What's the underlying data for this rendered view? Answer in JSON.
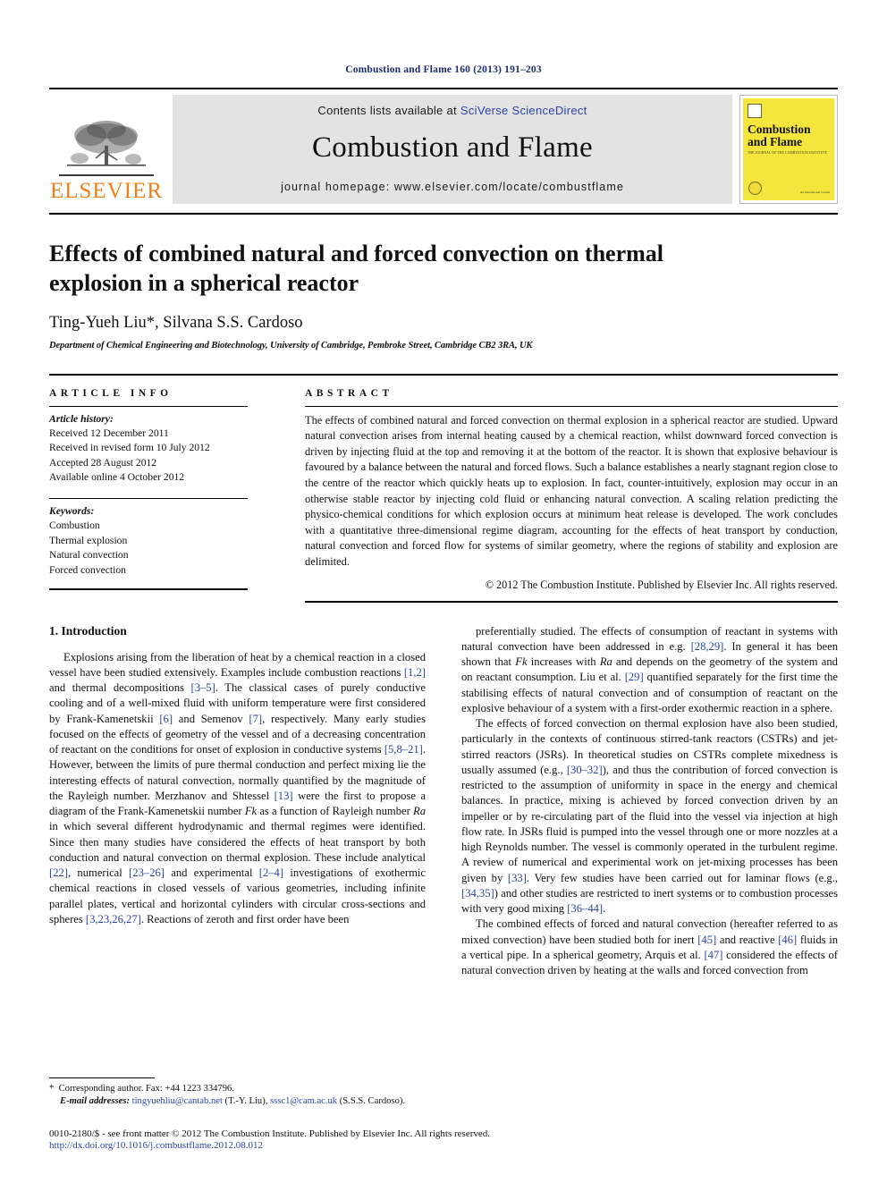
{
  "running_head": "Combustion and Flame 160 (2013) 191–203",
  "masthead": {
    "publisher_name": "ELSEVIER",
    "contents_prefix": "Contents lists available at ",
    "contents_link": "SciVerse ScienceDirect",
    "journal_name": "Combustion and Flame",
    "homepage": "journal homepage: www.elsevier.com/locate/combustflame",
    "cover": {
      "title_line1": "Combustion",
      "title_line2": "and Flame",
      "subtitle": "THE JOURNAL OF THE COMBUSTION INSTITUTE",
      "footer": "An International Journal"
    }
  },
  "article": {
    "title": "Effects of combined natural and forced convection on thermal explosion in a spherical reactor",
    "authors": "Ting-Yueh Liu*, Silvana S.S. Cardoso",
    "affiliation": "Department of Chemical Engineering and Biotechnology, University of Cambridge, Pembroke Street, Cambridge CB2 3RA, UK"
  },
  "article_info": {
    "heading": "ARTICLE INFO",
    "history_label": "Article history:",
    "history": [
      "Received 12 December 2011",
      "Received in revised form 10 July 2012",
      "Accepted 28 August 2012",
      "Available online 4 October 2012"
    ],
    "keywords_label": "Keywords:",
    "keywords": [
      "Combustion",
      "Thermal explosion",
      "Natural convection",
      "Forced convection"
    ]
  },
  "abstract": {
    "heading": "ABSTRACT",
    "text": "The effects of combined natural and forced convection on thermal explosion in a spherical reactor are studied. Upward natural convection arises from internal heating caused by a chemical reaction, whilst downward forced convection is driven by injecting fluid at the top and removing it at the bottom of the reactor. It is shown that explosive behaviour is favoured by a balance between the natural and forced flows. Such a balance establishes a nearly stagnant region close to the centre of the reactor which quickly heats up to explosion. In fact, counter-intuitively, explosion may occur in an otherwise stable reactor by injecting cold fluid or enhancing natural convection. A scaling relation predicting the physico-chemical conditions for which explosion occurs at minimum heat release is developed. The work concludes with a quantitative three-dimensional regime diagram, accounting for the effects of heat transport by conduction, natural convection and forced flow for systems of similar geometry, where the regions of stability and explosion are delimited.",
    "copyright": "© 2012 The Combustion Institute. Published by Elsevier Inc. All rights reserved."
  },
  "body": {
    "section_heading": "1. Introduction",
    "left_p1_a": "Explosions arising from the liberation of heat by a chemical reaction in a closed vessel have been studied extensively. Examples include combustion reactions ",
    "left_ref1": "[1,2]",
    "left_p1_b": " and thermal decompositions ",
    "left_ref2": "[3–5]",
    "left_p1_c": ". The classical cases of purely conductive cooling and of a well-mixed fluid with uniform temperature were first considered by Frank-Kamenetskii ",
    "left_ref3": "[6]",
    "left_p1_d": " and Semenov ",
    "left_ref4": "[7]",
    "left_p1_e": ", respectively. Many early studies focused on the effects of geometry of the vessel and of a decreasing concentration of reactant on the conditions for onset of explosion in conductive systems ",
    "left_ref5": "[5,8–21]",
    "left_p1_f": ". However, between the limits of pure thermal conduction and perfect mixing lie the interesting effects of natural convection, normally quantified by the magnitude of the Rayleigh number. Merzhanov and Shtessel ",
    "left_ref6": "[13]",
    "left_p1_g": " were the first to propose a diagram of the Frank-Kamenetskii number ",
    "left_sym1": "Fk",
    "left_p1_h": " as a function of Rayleigh number ",
    "left_sym2": "Ra",
    "left_p1_i": " in which several different hydrodynamic and thermal regimes were identified. Since then many studies have considered the effects of heat transport by both conduction and natural convection on thermal explosion. These include analytical ",
    "left_ref7": "[22]",
    "left_p1_j": ", numerical ",
    "left_ref8": "[23–26]",
    "left_p1_k": " and experimental ",
    "left_ref9": "[2–4]",
    "left_p1_l": " investigations of exothermic chemical reactions in closed vessels of various geometries, including infinite parallel plates, vertical and horizontal cylinders with circular cross-sections and spheres ",
    "left_ref10": "[3,23,26,27]",
    "left_p1_m": ". Reactions of zeroth and first order have been",
    "right_p1_a": "preferentially studied. The effects of consumption of reactant in systems with natural convection have been addressed in e.g. ",
    "right_ref1": "[28,29]",
    "right_p1_b": ". In general it has been shown that ",
    "right_sym1": "Fk",
    "right_p1_c": " increases with ",
    "right_sym2": "Ra",
    "right_p1_d": " and depends on the geometry of the system and on reactant consumption. Liu et al. ",
    "right_ref2": "[29]",
    "right_p1_e": " quantified separately for the first time the stabilising effects of natural convection and of consumption of reactant on the explosive behaviour of a system with a first-order exothermic reaction in a sphere.",
    "right_p2_a": "The effects of forced convection on thermal explosion have also been studied, particularly in the contexts of continuous stirred-tank reactors (CSTRs) and jet-stirred reactors (JSRs). In theoretical studies on CSTRs complete mixedness is usually assumed (e.g., ",
    "right_ref3": "[30–32]",
    "right_p2_b": "), and thus the contribution of forced convection is restricted to the assumption of uniformity in space in the energy and chemical balances. In practice, mixing is achieved by forced convection driven by an impeller or by re-circulating part of the fluid into the vessel via injection at high flow rate. In JSRs fluid is pumped into the vessel through one or more nozzles at a high Reynolds number. The vessel is commonly operated in the turbulent regime. A review of numerical and experimental work on jet-mixing processes has been given by ",
    "right_ref4": "[33]",
    "right_p2_c": ". Very few studies have been carried out for laminar flows (e.g., ",
    "right_ref5": "[34,35]",
    "right_p2_d": ") and other studies are restricted to inert systems or to combustion processes with very good mixing ",
    "right_ref6": "[36–44]",
    "right_p2_e": ".",
    "right_p3_a": "The combined effects of forced and natural convection (hereafter referred to as mixed convection) have been studied both for inert ",
    "right_ref7": "[45]",
    "right_p3_b": " and reactive ",
    "right_ref8": "[46]",
    "right_p3_c": " fluids in a vertical pipe. In a spherical geometry, Arquis et al. ",
    "right_ref9": "[47]",
    "right_p3_d": " considered the effects of natural convection driven by heating at the walls and forced convection from"
  },
  "footer": {
    "corresponding": "Corresponding author. Fax: +44 1223 334796.",
    "email_label": "E-mail addresses:",
    "email1": "tingyuehliu@cantab.net",
    "email1_owner": " (T.-Y. Liu), ",
    "email2": "sssc1@cam.ac.uk",
    "email2_owner": " (S.S.S. Cardoso).",
    "imprint": "0010-2180/$ - see front matter © 2012 The Combustion Institute. Published by Elsevier Inc. All rights reserved.",
    "doi": "http://dx.doi.org/10.1016/j.combustflame.2012.08.012"
  },
  "colors": {
    "link": "#2b43a8",
    "elsevier_orange": "#F07F1A",
    "cover_yellow": "#F5E63D",
    "banner_gray": "#e3e3e3",
    "running_head": "#1b2a6b"
  }
}
